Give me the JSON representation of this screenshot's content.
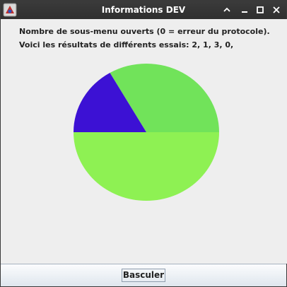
{
  "window": {
    "title": "Informations DEV",
    "icons": {
      "app": "app-icon",
      "up": "chevron-up-icon",
      "minimize": "minimize-icon",
      "maximize": "maximize-icon",
      "close": "close-icon"
    }
  },
  "content": {
    "line1": "Nombre de sous-menu ouverts (0 = erreur du protocole).",
    "line2": "Voici les résultats de différents essais: 2, 1, 3, 0,"
  },
  "chart_data": {
    "type": "pie",
    "values": [
      2,
      1,
      3,
      0
    ],
    "colors": [
      "#71e35a",
      "#3c11d4",
      "#8ef153",
      "#444444"
    ]
  },
  "button": {
    "label": "Basculer"
  },
  "colors": {
    "titlebar": "#333333",
    "window_bg": "#eeeeee"
  }
}
